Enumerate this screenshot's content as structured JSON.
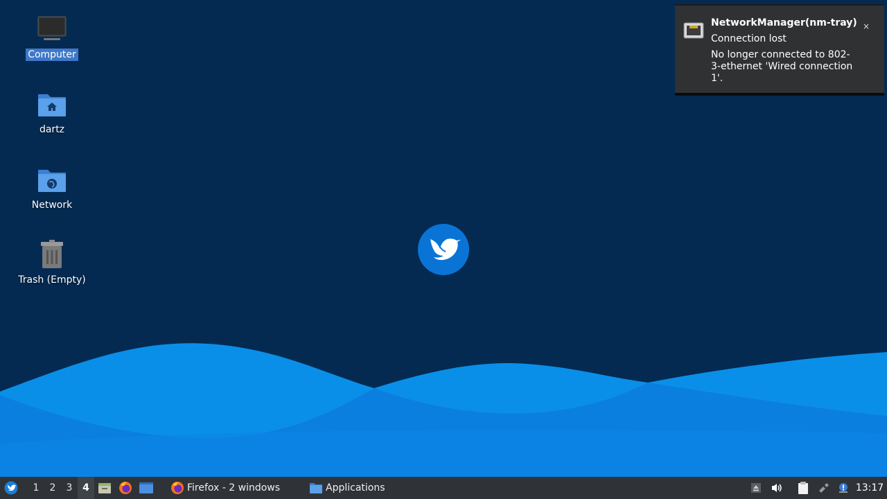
{
  "desktop": {
    "icons": [
      {
        "name": "computer",
        "label": "Computer",
        "selected": true,
        "icon": "monitor-icon"
      },
      {
        "name": "home",
        "label": "dartz",
        "selected": false,
        "icon": "home-folder-icon"
      },
      {
        "name": "network",
        "label": "Network",
        "selected": false,
        "icon": "network-folder-icon"
      },
      {
        "name": "trash",
        "label": "Trash (Empty)",
        "selected": false,
        "icon": "trash-icon"
      }
    ],
    "logo": "hummingbird-logo-icon",
    "colors": {
      "background": "#042a52",
      "wave_light": "#0a8fe8",
      "wave_dark": "#0067cc",
      "selection": "#3d78c9"
    }
  },
  "notification": {
    "title": "NetworkManager(nm-tray)",
    "summary": "Connection lost",
    "body": "No longer connected to 802-3-ethernet 'Wired connection 1'.",
    "close_label": "×",
    "icon": "ethernet-port-icon"
  },
  "taskbar": {
    "menu_icon": "start-menu-icon",
    "workspaces": [
      "1",
      "2",
      "3",
      "4"
    ],
    "active_workspace": "4",
    "launchers": [
      "file-manager-icon",
      "firefox-icon",
      "show-desktop-icon"
    ],
    "tasks": [
      {
        "label": "Firefox - 2 windows",
        "icon": "firefox-icon"
      },
      {
        "label": "Applications",
        "icon": "folder-icon"
      }
    ],
    "tray": [
      "eject-icon",
      "volume-icon",
      "clipboard-icon",
      "network-disconnected-icon",
      "notification-icon"
    ],
    "clock": "13:17"
  }
}
